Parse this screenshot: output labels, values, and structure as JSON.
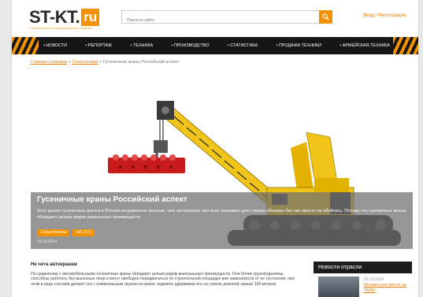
{
  "site": {
    "logo_main": "ST-KT.",
    "logo_ru": "ru",
    "logo_sub": "строительная и коммунальная техника"
  },
  "search": {
    "placeholder": "Поиск по сайту"
  },
  "auth": {
    "login": "Вход",
    "separator": " / ",
    "register": "Регистрация"
  },
  "nav": {
    "items": [
      "НОВОСТИ",
      "РЕПОРТАЖ",
      "ТЕХНИКА",
      "ПРОИЗВОДСТВО",
      "СТАТИСТИКА",
      "ПРОДАЖА ТЕХНИКИ",
      "АРМЕЙСКАЯ ТЕХНИКА"
    ]
  },
  "breadcrumb": {
    "home": "Главная страница",
    "sep": " > ",
    "section": "Спецтехника",
    "current": "Гусеничные краны Российский аспект"
  },
  "hero": {
    "title": "Гусеничные краны Российский аспект",
    "description": "Хотя рынок гусеничных кранов в России несравненно меньше, чем автокранов, при всех значимых для страны объемах без них просто не обойтись. Потому что гусеничные краны обладают целым рядом уникальных преимуществ.",
    "tags": [
      "Спецтехника",
      "№5 (17)"
    ],
    "date": "10.10.2014"
  },
  "article": {
    "heading": "Не чета автокранам",
    "text": "По сравнению с автомобильными гусеничные краны обладают целым рядом выигрышных преимуществ. Они более грузоподъемны, способны работать без выносных опор и могут свободно передвигаться по строительной площадке вне зависимости от ее состояния, при этом в ряде случаев делают это с номинальным грузом на крюке, надежно удерживая его на стреле длинной свыше 100 метров."
  },
  "news": {
    "heading": "Новости отрасли",
    "items": [
      {
        "date": "16.10.2014",
        "title": "Интересное место на TAPM"
      }
    ]
  },
  "colors": {
    "accent": "#f29200",
    "nav_bg": "#161616",
    "link": "#e07b00"
  },
  "icons": {
    "search_button": "magnifier-icon"
  }
}
